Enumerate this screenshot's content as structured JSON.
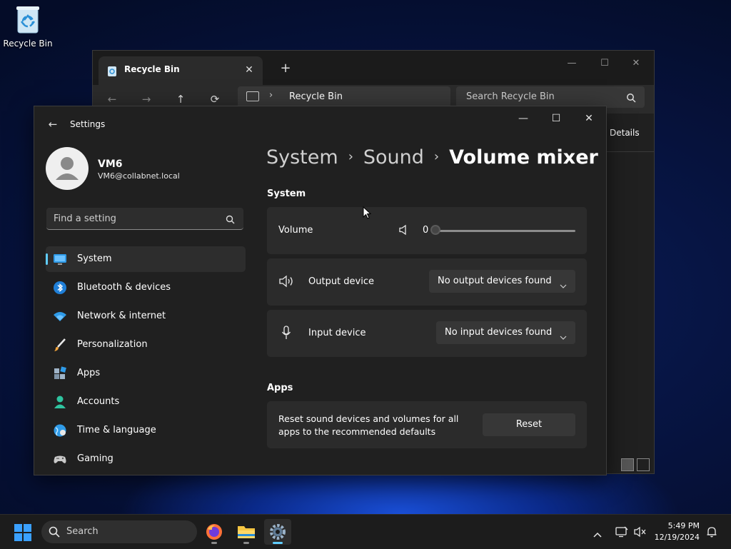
{
  "desktop": {
    "recycle_bin_label": "Recycle Bin"
  },
  "explorer": {
    "tab_title": "Recycle Bin",
    "tab_close": "✕",
    "new_tab": "+",
    "minimize": "—",
    "maximize": "☐",
    "close": "✕",
    "nav_back": "←",
    "nav_forward": "→",
    "nav_up": "↑",
    "nav_refresh": "⟳",
    "address_chevron": "›",
    "address_location": "Recycle Bin",
    "search_placeholder": "Search Recycle Bin",
    "details_label": "Details"
  },
  "settings": {
    "back": "←",
    "app_title": "Settings",
    "minimize": "—",
    "maximize": "☐",
    "close": "✕",
    "profile": {
      "name": "VM6",
      "email": "VM6@collabnet.local"
    },
    "search_placeholder": "Find a setting",
    "nav": [
      {
        "label": "System",
        "icon": "system-icon",
        "selected": true
      },
      {
        "label": "Bluetooth & devices",
        "icon": "bluetooth-icon"
      },
      {
        "label": "Network & internet",
        "icon": "wifi-icon"
      },
      {
        "label": "Personalization",
        "icon": "brush-icon"
      },
      {
        "label": "Apps",
        "icon": "apps-icon"
      },
      {
        "label": "Accounts",
        "icon": "person-icon"
      },
      {
        "label": "Time & language",
        "icon": "globe-icon"
      },
      {
        "label": "Gaming",
        "icon": "gamepad-icon"
      }
    ],
    "breadcrumb": {
      "level1": "System",
      "level2": "Sound",
      "current": "Volume mixer",
      "separator": "›"
    },
    "system_heading": "System",
    "volume": {
      "label": "Volume",
      "value": "0",
      "level": 0
    },
    "output": {
      "label": "Output device",
      "selected": "No output devices found"
    },
    "input": {
      "label": "Input device",
      "selected": "No input devices found"
    },
    "apps_heading": "Apps",
    "reset": {
      "description": "Reset sound devices and volumes for all apps to the recommended defaults",
      "button": "Reset"
    }
  },
  "taskbar": {
    "search_label": "Search",
    "pinned": [
      {
        "name": "firefox-icon"
      },
      {
        "name": "file-explorer-icon"
      },
      {
        "name": "settings-app-icon",
        "active": true
      }
    ],
    "time": "5:49 PM",
    "date": "12/19/2024"
  },
  "colors": {
    "accent": "#60cdff",
    "window_bg": "#202020",
    "card_bg": "#2b2b2b",
    "taskbar_bg": "#1c1c1c"
  }
}
